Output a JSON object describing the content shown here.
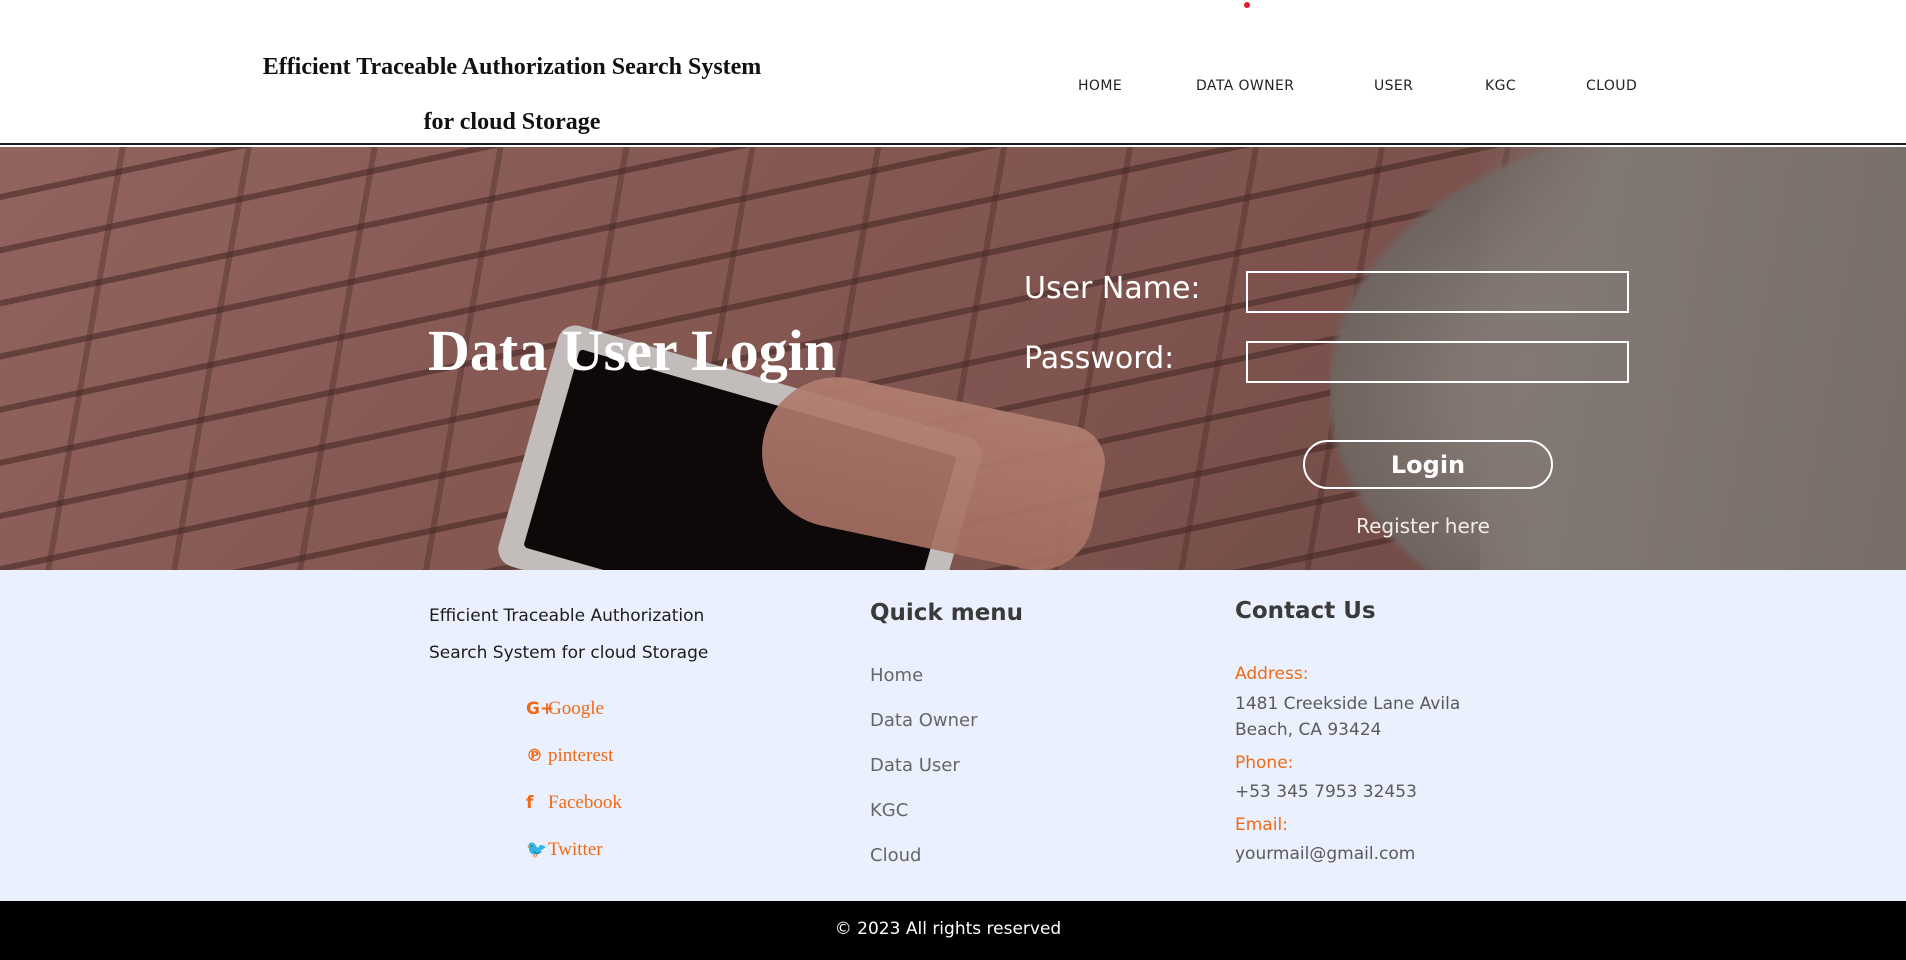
{
  "header": {
    "title_line1": "Efficient Traceable Authorization Search System",
    "title_line2": "for cloud Storage",
    "nav": [
      "HOME",
      "DATA OWNER",
      "USER",
      "KGC",
      "CLOUD"
    ]
  },
  "hero": {
    "heading": "Data User Login",
    "username_label": "User Name:",
    "username_value": "",
    "password_label": "Password:",
    "password_value": "",
    "login_label": "Login",
    "register_label": "Register here"
  },
  "footer": {
    "about_line1": "Efficient Traceable Authorization",
    "about_line2": "Search System for cloud Storage",
    "social": [
      {
        "icon": "google-plus-icon",
        "glyph": "G+",
        "label": "Google"
      },
      {
        "icon": "pinterest-icon",
        "glyph": "℗",
        "label": "pinterest"
      },
      {
        "icon": "facebook-icon",
        "glyph": "f",
        "label": "Facebook"
      },
      {
        "icon": "twitter-icon",
        "glyph": "🐦",
        "label": "Twitter"
      }
    ],
    "quick_menu_heading": "Quick menu",
    "quick_menu": [
      "Home",
      "Data Owner",
      "Data User",
      "KGC",
      "Cloud"
    ],
    "contact_heading": "Contact Us",
    "address_label": "Address:",
    "address_value": "1481 Creekside Lane Avila Beach, CA 93424",
    "phone_label": "Phone:",
    "phone_value": "+53 345 7953 32453",
    "email_label": "Email:",
    "email_value": "yourmail@gmail.com",
    "copyright": "© 2023 All rights reserved"
  },
  "colors": {
    "accent": "#f06a16",
    "footer_bg": "#eaf0fd",
    "copyright_bg": "#000000"
  }
}
